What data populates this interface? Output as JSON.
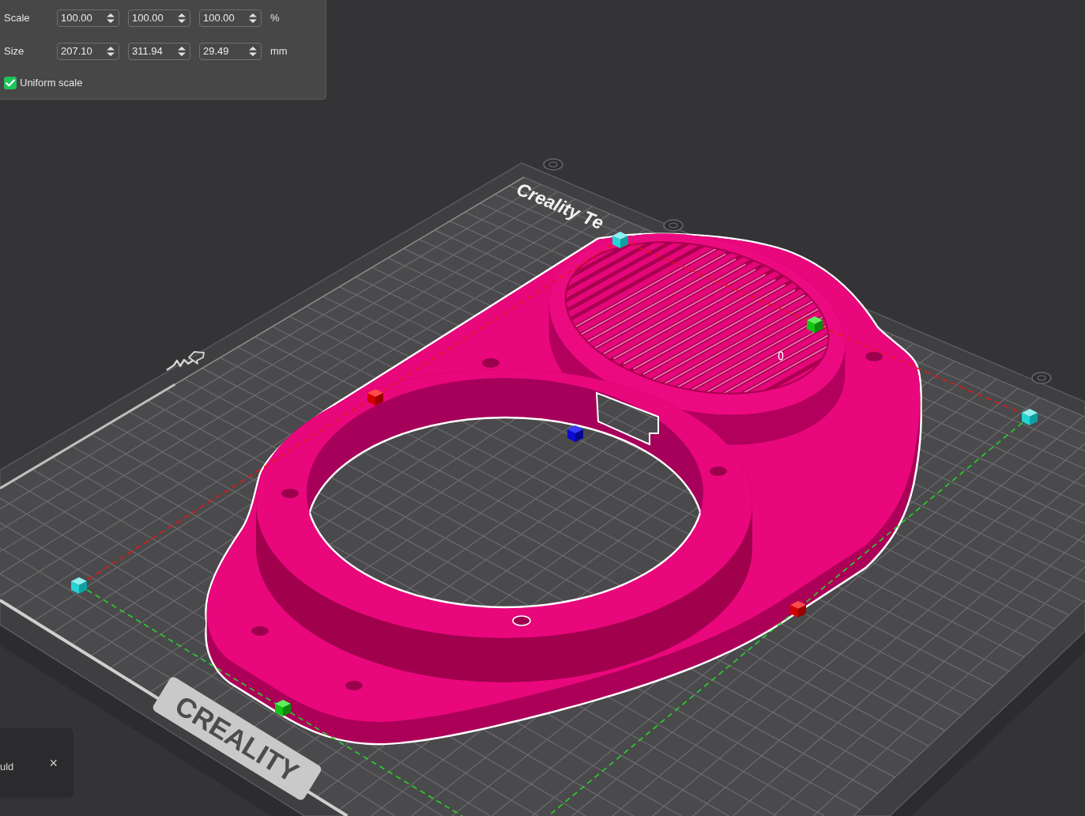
{
  "panel": {
    "rows": [
      {
        "label": "Scale",
        "values": [
          "100.00",
          "100.00",
          "100.00"
        ],
        "unit": "%"
      },
      {
        "label": "Size",
        "values": [
          "207.10",
          "311.94",
          "29.49"
        ],
        "unit": "mm"
      }
    ],
    "uniform_scale": {
      "label": "Uniform scale",
      "checked": true
    }
  },
  "viewport": {
    "plate_labels": [
      {
        "kind": "print",
        "text": "Creality Te"
      },
      {
        "kind": "plaque",
        "text": "CREALITY"
      }
    ]
  },
  "notification": {
    "text": "uld",
    "close": "×"
  }
}
